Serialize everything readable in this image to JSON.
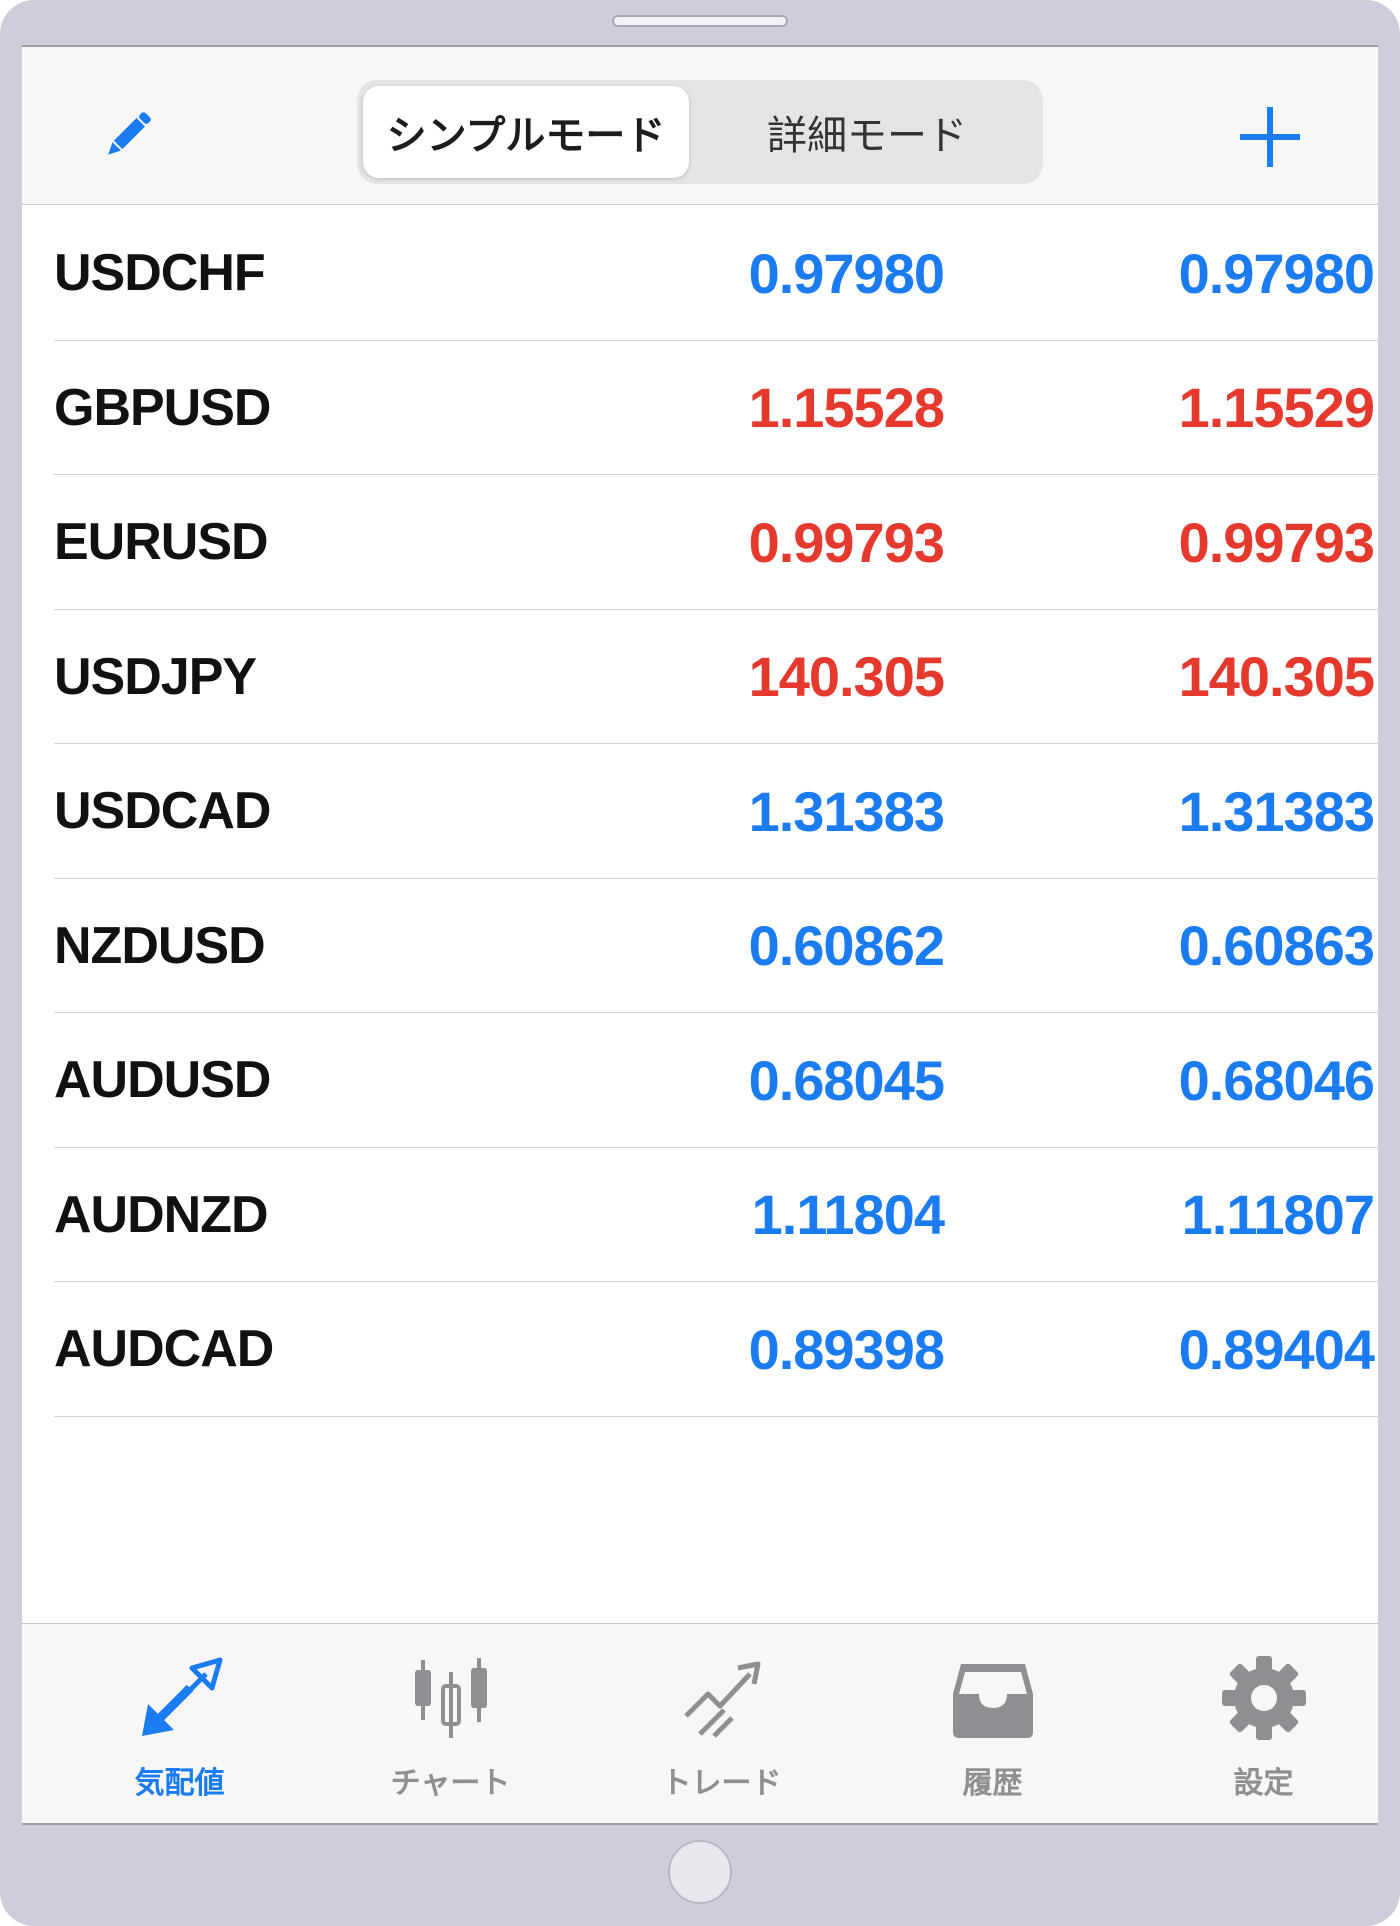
{
  "colors": {
    "accent": "#1b7cf2",
    "up": "#1b7cf2",
    "down": "#e5392d",
    "tab_inactive": "#8e8e93"
  },
  "navbar": {
    "edit_icon": "pencil-icon",
    "add_icon": "plus-icon",
    "segments": {
      "simple": "シンプルモード",
      "detailed": "詳細モード",
      "selected": "simple"
    }
  },
  "quotes": [
    {
      "symbol": "USDCHF",
      "bid": "0.97980",
      "ask": "0.97980",
      "color": "#1b7cf2"
    },
    {
      "symbol": "GBPUSD",
      "bid": "1.15528",
      "ask": "1.15529",
      "color": "#e5392d"
    },
    {
      "symbol": "EURUSD",
      "bid": "0.99793",
      "ask": "0.99793",
      "color": "#e5392d"
    },
    {
      "symbol": "USDJPY",
      "bid": "140.305",
      "ask": "140.305",
      "color": "#e5392d"
    },
    {
      "symbol": "USDCAD",
      "bid": "1.31383",
      "ask": "1.31383",
      "color": "#1b7cf2"
    },
    {
      "symbol": "NZDUSD",
      "bid": "0.60862",
      "ask": "0.60863",
      "color": "#1b7cf2"
    },
    {
      "symbol": "AUDUSD",
      "bid": "0.68045",
      "ask": "0.68046",
      "color": "#1b7cf2"
    },
    {
      "symbol": "AUDNZD",
      "bid": "1.11804",
      "ask": "1.11807",
      "color": "#1b7cf2"
    },
    {
      "symbol": "AUDCAD",
      "bid": "0.89398",
      "ask": "0.89404",
      "color": "#1b7cf2"
    }
  ],
  "tabbar": {
    "items": [
      {
        "label": "気配値",
        "icon": "quotes-arrows-icon",
        "active": true
      },
      {
        "label": "チャート",
        "icon": "candlestick-chart-icon",
        "active": false
      },
      {
        "label": "トレード",
        "icon": "trade-trend-icon",
        "active": false
      },
      {
        "label": "履歴",
        "icon": "history-inbox-icon",
        "active": false
      },
      {
        "label": "設定",
        "icon": "gear-icon",
        "active": false
      }
    ]
  }
}
